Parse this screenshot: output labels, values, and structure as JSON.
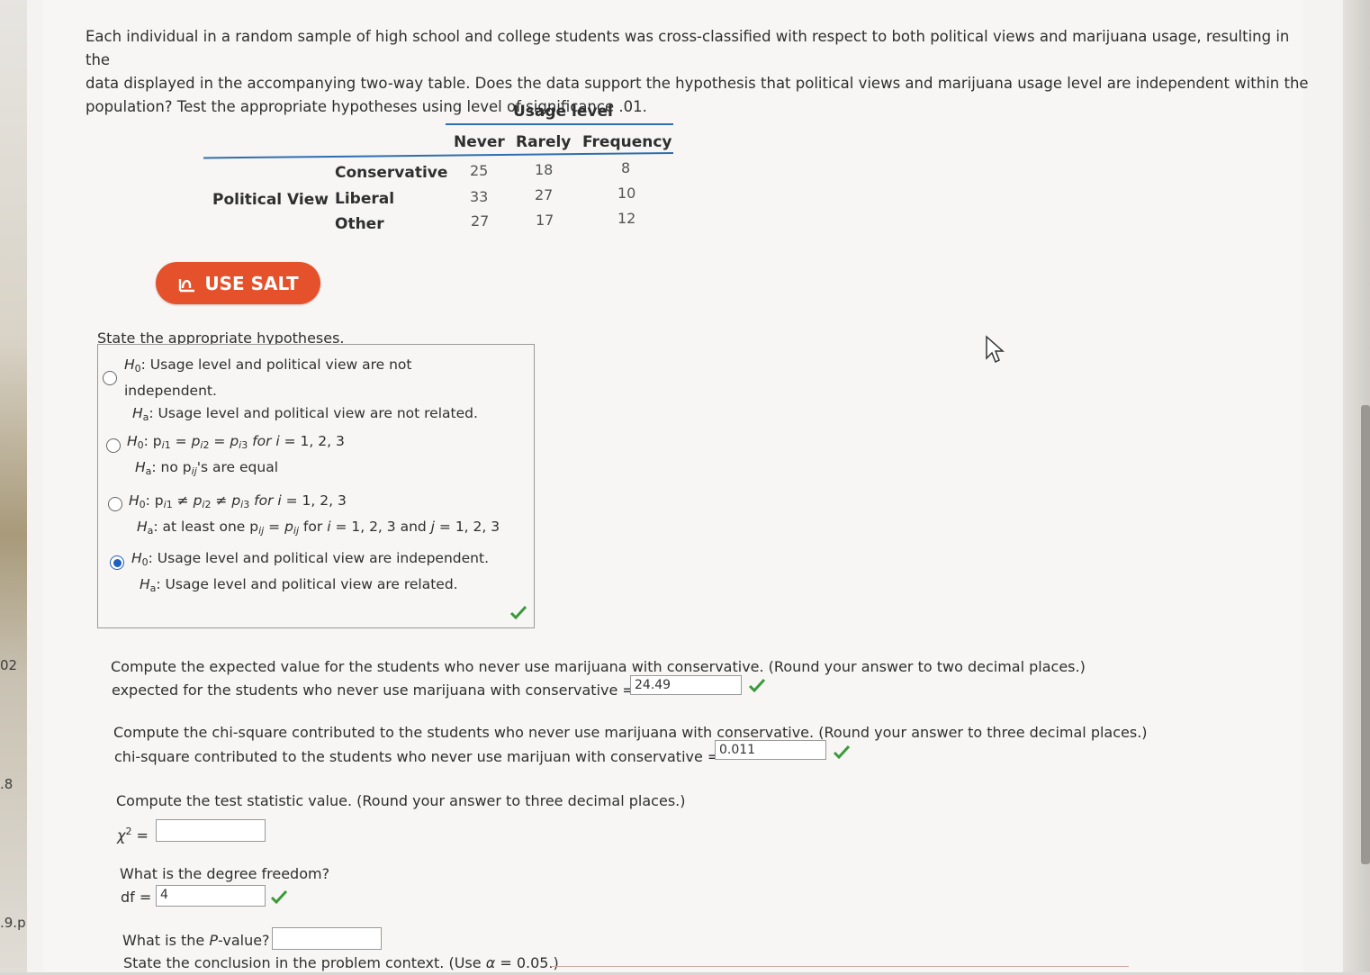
{
  "question": {
    "prompt_line1": "Each individual in a random sample of high school and college students was cross-classified with respect to both political views and marijuana usage, resulting in the",
    "prompt_line2": "data displayed in the accompanying two-way table. Does the data support the hypothesis that political views and marijuana usage level are independent within the",
    "prompt_line3": "population? Test the appropriate hypotheses using level of significance .01."
  },
  "table": {
    "usage_header": "Usage level",
    "columns": [
      "Never",
      "Rarely",
      "Frequency"
    ],
    "row_group_label": "Political View",
    "rows": [
      {
        "label": "Conservative",
        "values": [
          "25",
          "18",
          "8"
        ]
      },
      {
        "label": "Liberal",
        "values": [
          "33",
          "27",
          "10"
        ]
      },
      {
        "label": "Other",
        "values": [
          "27",
          "17",
          "12"
        ]
      }
    ]
  },
  "salt_button": {
    "label": "USE SALT"
  },
  "hypotheses": {
    "title": "State the appropriate hypotheses.",
    "options": [
      {
        "h0_a": "H",
        "h0_text": ": Usage level and political view are not",
        "h0_text2": "independent.",
        "ha_text": ": Usage level and political view are not related.",
        "selected": false
      },
      {
        "h0_text": ": p",
        "ha_text": ": no p",
        "selected": false
      },
      {
        "h0_text": ": p",
        "ha_text": ": at least one p",
        "selected": false
      },
      {
        "h0_text": ": Usage level and political view are independent.",
        "ha_text": ": Usage level and political view are related.",
        "selected": true
      }
    ]
  },
  "expected": {
    "question": "Compute the expected value for the students who never use marijuana with conservative. (Round your answer to two decimal places.)",
    "label": "expected for the students who never use marijuana with conservative =",
    "value": "24.49"
  },
  "chisq_contrib": {
    "question": "Compute the chi-square contributed to the students who never use marijuana with conservative. (Round your answer to three decimal places.)",
    "label": "chi-square contributed to the students who never use marijuan with conservative =",
    "value": "0.011"
  },
  "test_stat": {
    "question": "Compute the test statistic value. (Round your answer to three decimal places.)",
    "value": ""
  },
  "df": {
    "question": "What is the degree freedom?",
    "label": "df =",
    "value": "4"
  },
  "pvalue": {
    "question": "What is the",
    "value": ""
  },
  "conclusion": {
    "question_a": "State the conclusion in the problem context. (Use",
    "question_b": "= 0.05.)"
  },
  "edge_labels": [
    "02",
    ".8",
    ".9.p"
  ],
  "colors": {
    "salt": "#e5512a",
    "rule": "#2f6eb0",
    "check": "#3a9a3a",
    "radio": "#1f5fbf"
  }
}
